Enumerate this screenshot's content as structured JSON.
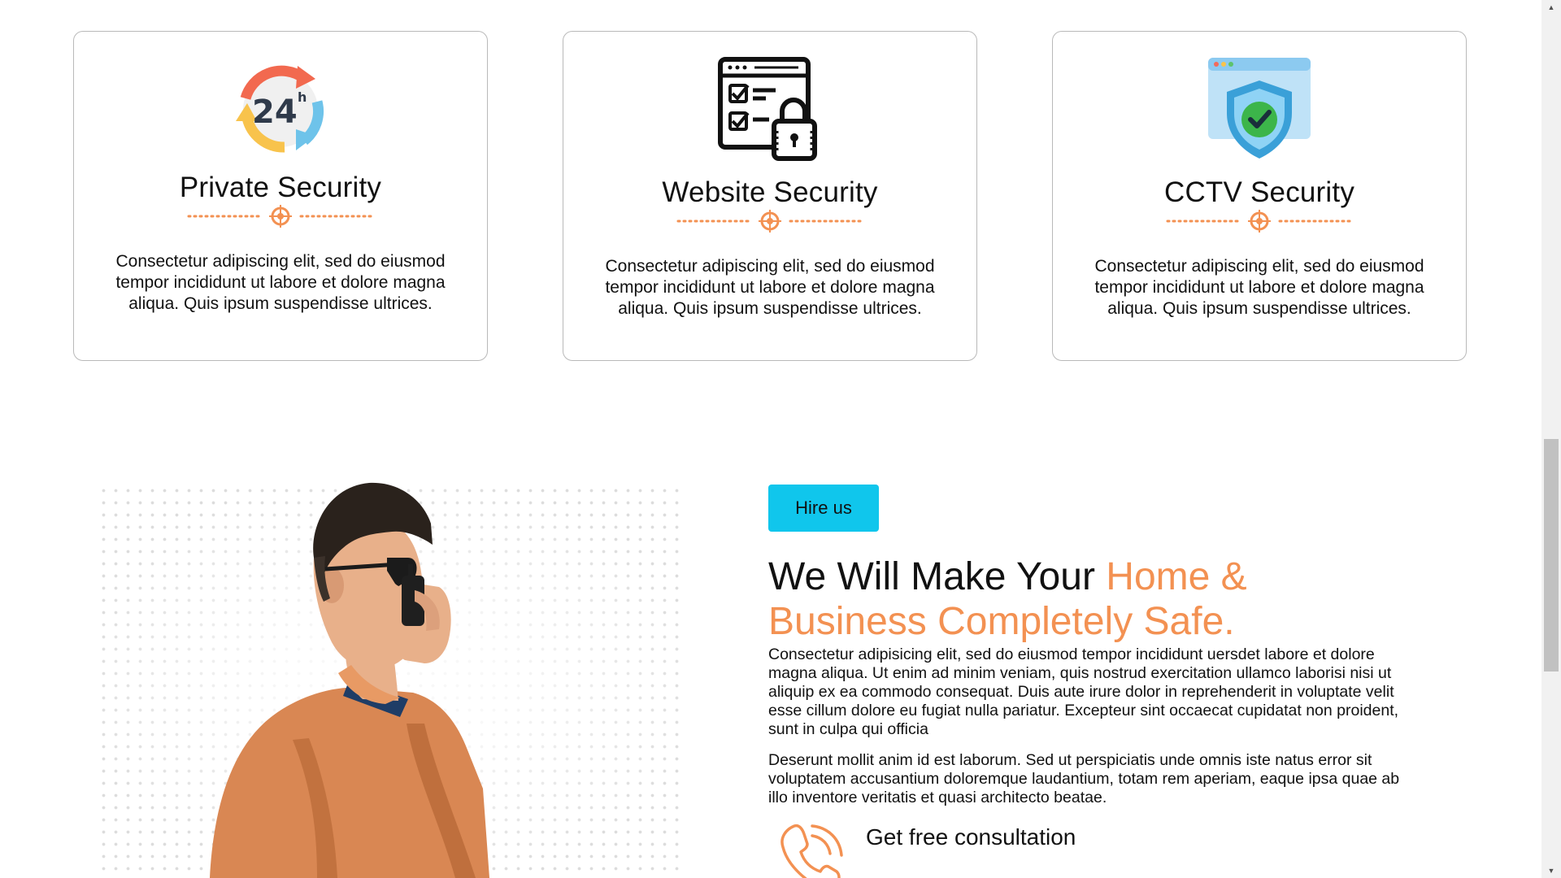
{
  "services": [
    {
      "title": "Private Security",
      "icon": "24h-clock-icon",
      "description": "Consectetur adipiscing elit, sed do eiusmod tempor incididunt ut labore et dolore magna aliqua. Quis ipsum suspendisse ultrices."
    },
    {
      "title": "Website Security",
      "icon": "website-lock-icon",
      "description": "Consectetur adipiscing elit, sed do eiusmod tempor incididunt ut labore et dolore magna aliqua. Quis ipsum suspendisse ultrices."
    },
    {
      "title": "CCTV Security",
      "icon": "shield-check-icon",
      "description": "Consectetur adipiscing elit, sed do eiusmod tempor incididunt ut labore et dolore magna aliqua. Quis ipsum suspendisse ultrices."
    }
  ],
  "hire": {
    "button_label": "Hire us",
    "headline_plain": "We Will Make Your",
    "headline_accent": "Home & Business Completely Safe.",
    "paragraph_1": "Consectetur adipisicing elit, sed do eiusmod tempor incididunt uersdet labore et dolore magna aliqua. Ut enim ad minim veniam, quis nostrud exercitation ullamco laborisi nisi ut aliquip ex ea commodo consequat. Duis aute irure dolor in reprehenderit in voluptate velit esse cillum dolore eu fugiat nulla pariatur. Excepteur sint occaecat cupidatat non proident, sunt in culpa qui officia",
    "paragraph_2": "Deserunt mollit anim id est laborum. Sed ut perspiciatis unde omnis iste natus error sit voluptatem accusantium doloremque laudantium, totam rem aperiam, eaque ipsa quae ab illo inventore veritatis et quasi architecto beatae.",
    "consultation_label": "Get free consultation",
    "consultation_icon": "phone-icon"
  },
  "colors": {
    "accent": "#f39152",
    "button": "#10c6ec",
    "text": "#111111",
    "card_border": "#b9b9b9"
  }
}
